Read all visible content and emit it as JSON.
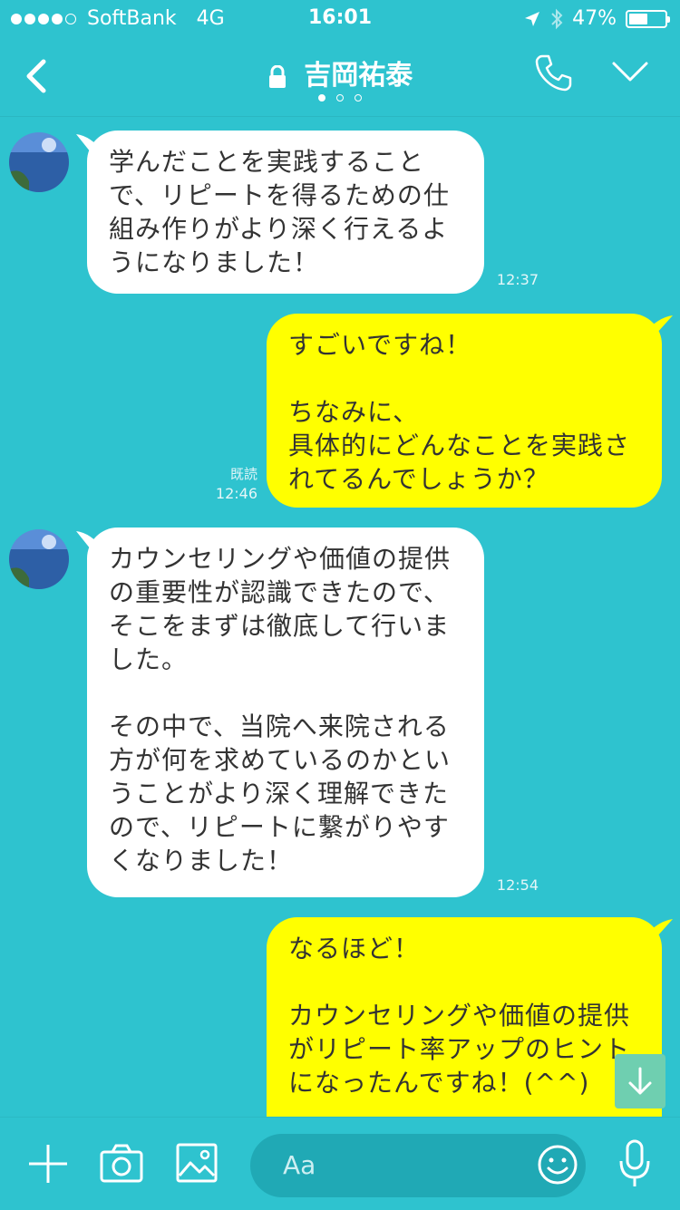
{
  "status_bar": {
    "carrier": "SoftBank",
    "network": "4G",
    "time": "16:01",
    "battery": "47%",
    "battery_level": 0.47
  },
  "header": {
    "title": "吉岡祐泰",
    "page_count": 3,
    "active_page": 0
  },
  "messages": [
    {
      "side": "in",
      "text": "学んだことを実践することで、リピートを得るための仕組み作りがより深く行えるようになりました！",
      "lines": "学んだことを実践すること\nで、リピートを得るための仕\n組み作りがより深く行えるよ\nうになりました！",
      "time": "12:37"
    },
    {
      "side": "out",
      "lines": "すごいですね！\n\nちなみに、\n具体的にどんなことを実践さ\nれてるんでしょうか？",
      "read": "既読",
      "time": "12:46"
    },
    {
      "side": "in",
      "lines": "カウンセリングや価値の提供\nの重要性が認識できたので、\nそこをまずは徹底して行いま\nした。\n\nその中で、当院へ来院される\n方が何を求めているのかとい\nうことがより深く理解できた\nので、リピートに繋がりやす\nくなりました！",
      "time": "12:54"
    },
    {
      "side": "out",
      "lines": "なるほど！\n\nカウンセリングや価値の提供\nがリピート率アップのヒント\nになったんですね！(^^)"
    }
  ],
  "input": {
    "placeholder": "Aa"
  },
  "colors": {
    "background": "#2ec3cf",
    "outgoing": "#ffff00",
    "incoming": "#ffffff"
  }
}
